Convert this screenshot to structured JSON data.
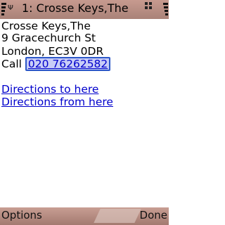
{
  "status_bar": {
    "title": "1: Crosse Keys,The",
    "network_indicator": "Ψ",
    "signal_icon": "signal-strength-icon",
    "battery_icon": "battery-icon",
    "app_icon": "grid-icon"
  },
  "place": {
    "name": "Crosse Keys,The",
    "street": "9 Gracechurch St",
    "city_postcode": "London, EC3V 0DR",
    "call_label": "Call",
    "phone": "020 76262582"
  },
  "links": {
    "directions_to": "Directions to here",
    "directions_from": "Directions from here"
  },
  "softkeys": {
    "left": "Options",
    "right": "Done"
  }
}
